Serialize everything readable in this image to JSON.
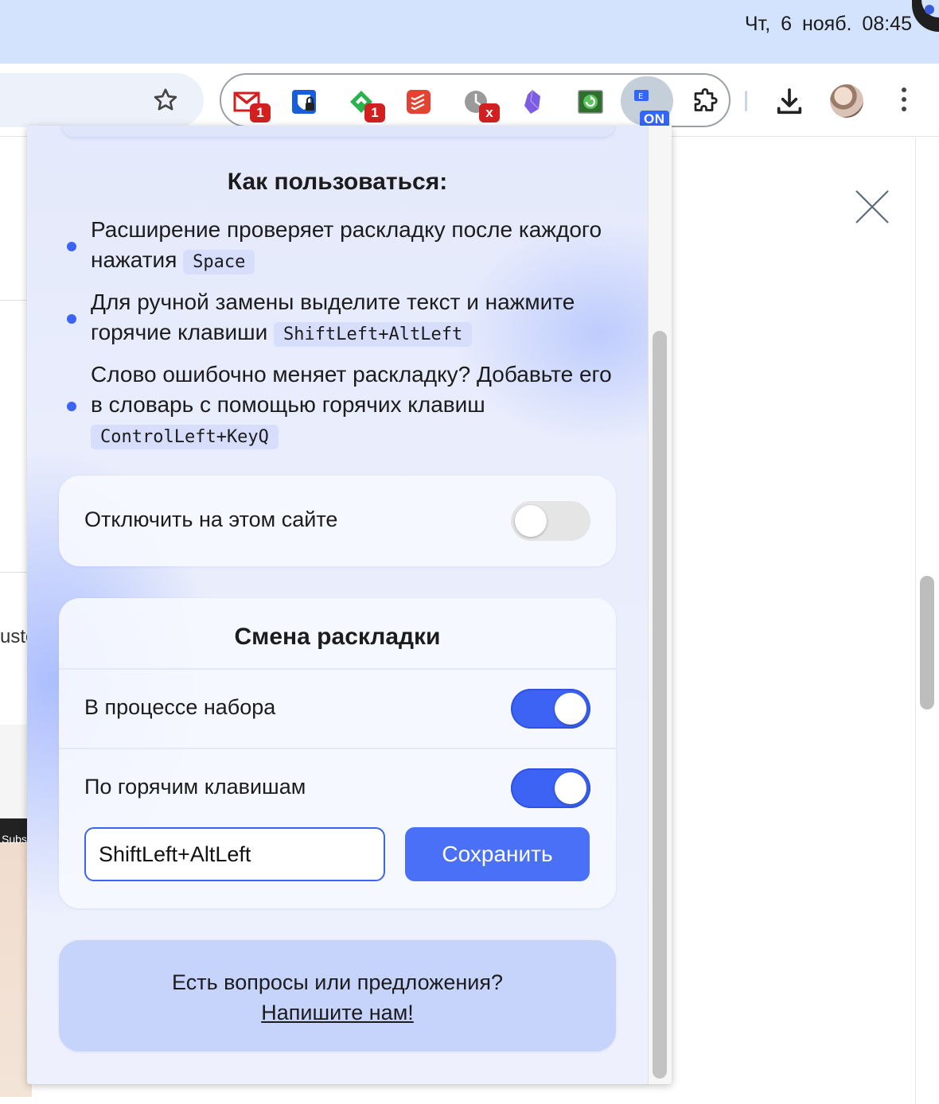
{
  "menubar": {
    "clock": "Чт, 6 нояб.  08:45"
  },
  "toolbar": {
    "extensions": [
      {
        "name": "gmail",
        "badge": "1",
        "color": "#d21f1f"
      },
      {
        "name": "bitwarden",
        "badge": "",
        "color": "#175ddc"
      },
      {
        "name": "feedly",
        "badge": "1",
        "color": "#2bb24c"
      },
      {
        "name": "todoist",
        "badge": "",
        "color": "#e44332"
      },
      {
        "name": "clock-disabled",
        "badge": "x",
        "color": "#8a8a8a"
      },
      {
        "name": "obsidian",
        "badge": "",
        "color": "#7c5ce0"
      },
      {
        "name": "screen-reload",
        "badge": "",
        "color": "#3a9a3a"
      },
      {
        "name": "layout-switcher",
        "badge": "ON",
        "color": "#3366ff"
      }
    ],
    "active_extension_badge": "ON",
    "active_extension_letter": "E"
  },
  "background_page": {
    "side_text": "uste",
    "dark_text": "Subs"
  },
  "popup": {
    "how_to_title": "Как пользоваться:",
    "tips": [
      {
        "text": "Расширение проверяет раскладку после каждого нажатия",
        "key": "Space"
      },
      {
        "text": "Для ручной замены выделите текст и нажмите горячие клавиши",
        "key": "ShiftLeft+AltLeft"
      },
      {
        "text": "Слово ошибочно меняет раскладку? Добавьте его в словарь с помощью горячих клавиш",
        "key": "ControlLeft+KeyQ"
      }
    ],
    "disable_on_site": {
      "label": "Отключить на этом сайте",
      "enabled": false
    },
    "layout_switch": {
      "title": "Смена раскладки",
      "while_typing": {
        "label": "В процессе набора",
        "enabled": true
      },
      "by_hotkeys": {
        "label": "По горячим клавишам",
        "enabled": true
      },
      "hotkey_value": "ShiftLeft+AltLeft",
      "save_label": "Сохранить"
    },
    "feedback": {
      "question": "Есть вопросы или предложения?",
      "link": "Напишите нам!"
    }
  },
  "colors": {
    "accent": "#3d63f5",
    "button": "#4a70f7",
    "feedback_bg": "#c6d3fb",
    "menubar_bg": "#d3e3fd"
  }
}
